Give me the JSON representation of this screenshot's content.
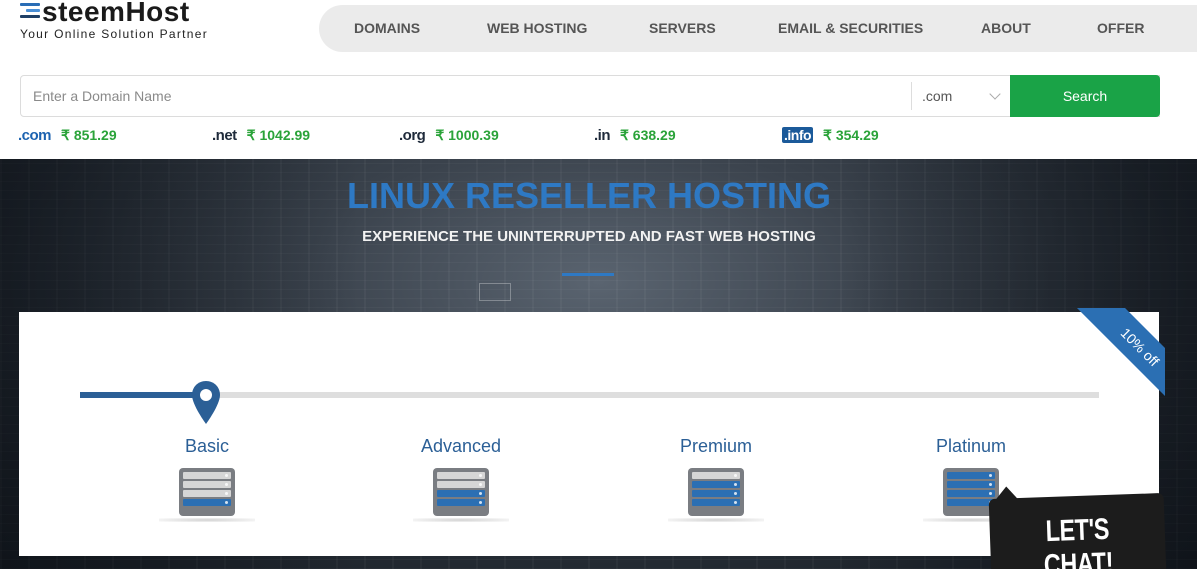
{
  "logo": {
    "name": "steemHost",
    "tagline": "Your Online Solution Partner"
  },
  "nav": {
    "items": [
      "DOMAINS",
      "WEB HOSTING",
      "SERVERS",
      "EMAIL & SECURITIES",
      "ABOUT",
      "OFFER"
    ]
  },
  "search": {
    "placeholder": "Enter a Domain Name",
    "value": "",
    "tld_selected": ".com",
    "button_label": "Search"
  },
  "prices": [
    {
      "tld": ".com",
      "price": "₹ 851.29"
    },
    {
      "tld": ".net",
      "price": "₹ 1042.99"
    },
    {
      "tld": ".org",
      "price": "₹ 1000.39"
    },
    {
      "tld": ".in",
      "price": "₹ 638.29"
    },
    {
      "tld": ".info",
      "price": "₹ 354.29"
    }
  ],
  "hero": {
    "title": "LINUX RESELLER HOSTING",
    "subtitle": "EXPERIENCE THE UNINTERRUPTED AND FAST WEB HOSTING"
  },
  "plans": {
    "ribbon": "10% off",
    "selected_index": 0,
    "items": [
      {
        "name": "Basic",
        "level": 1
      },
      {
        "name": "Advanced",
        "level": 2
      },
      {
        "name": "Premium",
        "level": 3
      },
      {
        "name": "Platinum",
        "level": 4
      }
    ]
  },
  "chat": {
    "label": "LET'S CHAT!"
  },
  "colors": {
    "primary": "#2b6fb3",
    "green": "#1aa347",
    "price_green": "#2aa339",
    "nav_bg": "#ebebeb"
  }
}
